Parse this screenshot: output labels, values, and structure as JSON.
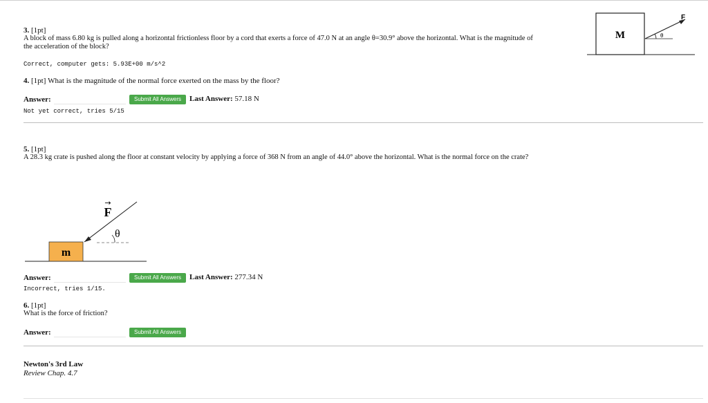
{
  "q3": {
    "number": "3.",
    "points": "[1pt]",
    "text_line1": "A block of mass 6.80 kg is pulled along a horizontal frictionless floor by a cord that exerts a force of 47.0 N at an angle θ=30.9° above the horizontal. What is the magnitude of",
    "text_line2": "the acceleration of the block?",
    "status": "Correct, computer gets: 5.93E+00 m/s^2",
    "diagram": {
      "mass_label": "M",
      "force_label": "F",
      "angle_label": "θ"
    }
  },
  "q4": {
    "number": "4.",
    "points": "[1pt]",
    "text": "What is the magnitude of the normal force exerted on the mass by the floor?",
    "answer_label": "Answer:",
    "answer_value": "",
    "submit_label": "Submit All Answers",
    "last_answer_label": "Last Answer:",
    "last_answer_value": "57.18 N",
    "status": "Not yet correct, tries 5/15"
  },
  "q5": {
    "number": "5.",
    "points": "[1pt]",
    "text": "A 28.3 kg crate is pushed along the floor at constant velocity by applying a force of 368 N from an angle of 44.0° above the horizontal. What is the normal force on the crate?",
    "diagram": {
      "mass_label": "m",
      "force_label": "F",
      "arrow_glyph": "→",
      "angle_label": "θ",
      "box_color": "#f5b04d"
    },
    "answer_label": "Answer:",
    "answer_value": "",
    "submit_label": "Submit All Answers",
    "last_answer_label": "Last Answer:",
    "last_answer_value": "277.34 N",
    "status": "Incorrect, tries 1/15."
  },
  "q6": {
    "number": "6.",
    "points": "[1pt]",
    "text": "What is the force of friction?",
    "answer_label": "Answer:",
    "answer_value": "",
    "submit_label": "Submit All Answers"
  },
  "footer": {
    "title": "Newton's 3rd Law",
    "subtitle": "Review Chap. 4.7"
  },
  "colors": {
    "button_green": "#4aa84a",
    "box_orange": "#f5b04d"
  }
}
